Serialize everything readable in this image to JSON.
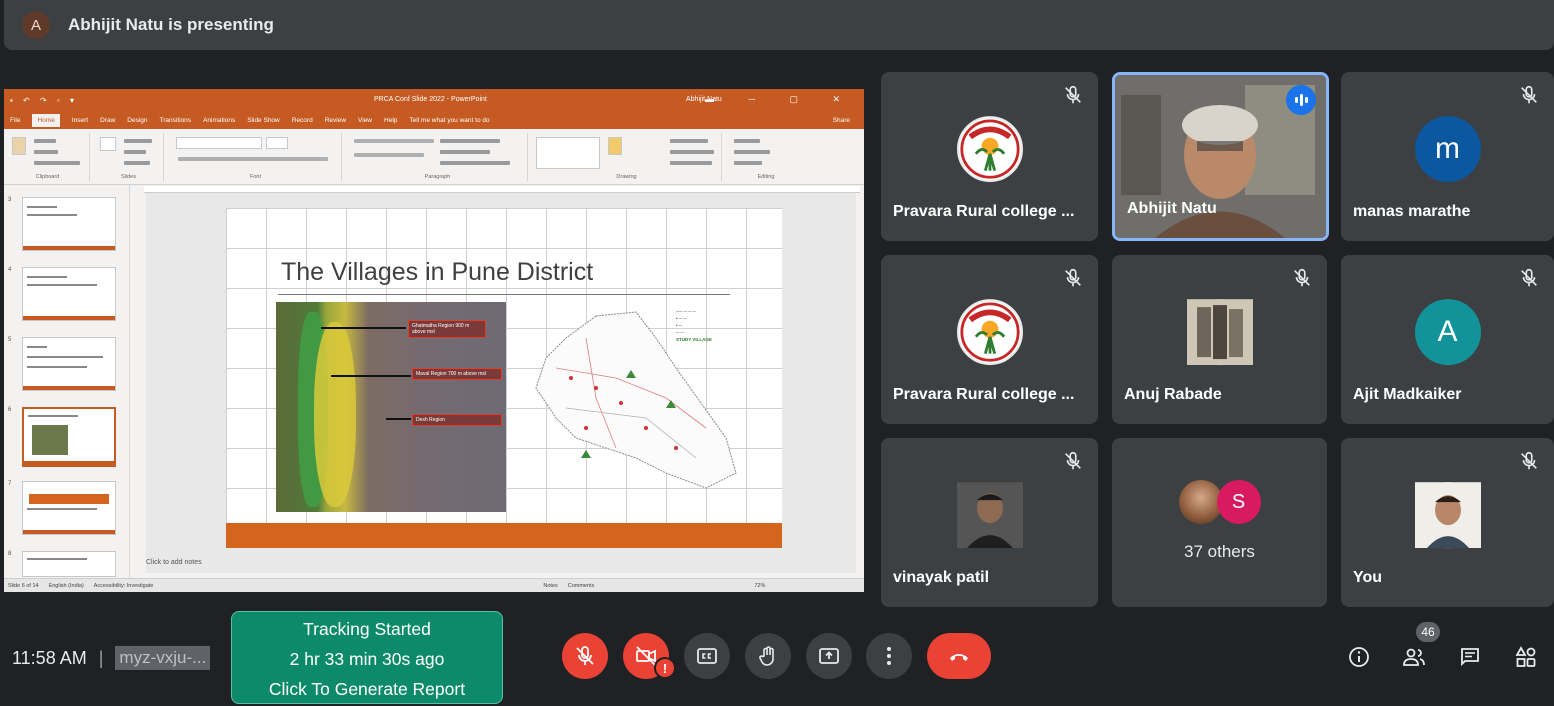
{
  "presenter_banner": {
    "avatar_letter": "A",
    "text": "Abhijit Natu is presenting"
  },
  "shared_screen": {
    "window_title": "PRCA Conf Slide 2022 - PowerPoint",
    "user": "Abhijit Natu",
    "ribbon_tabs": [
      "File",
      "Home",
      "Insert",
      "Draw",
      "Design",
      "Transitions",
      "Animations",
      "Slide Show",
      "Record",
      "Review",
      "View",
      "Help",
      "Tell me what you want to do"
    ],
    "share_label": "Share",
    "ribbon_groups": [
      "Clipboard",
      "Slides",
      "Font",
      "Paragraph",
      "Drawing",
      "Editing"
    ],
    "slide_numbers": [
      "3",
      "4",
      "5",
      "6",
      "7",
      "8"
    ],
    "slide_title": "The Villages in Pune District",
    "callouts": [
      "Ghatmatha Region 900 m above msl",
      "Maval Region 700 m above msl",
      "Desh Region"
    ],
    "map_legend_title": "STUDY VILLAGE",
    "notes_placeholder": "Click to add notes",
    "status_left": "Slide 6 of 14",
    "status_lang": "English (India)",
    "status_access": "Accessibility: Investigate",
    "status_notes": "Notes",
    "status_comments": "Comments",
    "zoom": "72%"
  },
  "participants": [
    {
      "name": "Pravara Rural college ...",
      "type": "logo",
      "muted": true
    },
    {
      "name": "Abhijit Natu",
      "type": "video",
      "speaking": true
    },
    {
      "name": "manas marathe",
      "type": "letter",
      "letter": "m",
      "color": "#0b57a0",
      "muted": true
    },
    {
      "name": "Pravara Rural college ...",
      "type": "logo",
      "muted": true
    },
    {
      "name": "Anuj Rabade",
      "type": "photo",
      "muted": true
    },
    {
      "name": "Ajit Madkaiker",
      "type": "letter",
      "letter": "A",
      "color": "#12939a",
      "muted": true
    },
    {
      "name": "vinayak patil",
      "type": "photo",
      "muted": true
    },
    {
      "name": "37 others",
      "type": "others",
      "letter": "S"
    },
    {
      "name": "You",
      "type": "photo",
      "muted": true
    }
  ],
  "bottom_bar": {
    "time": "11:58 AM",
    "meeting_code": "myz-vxju-...",
    "tracking": {
      "line1": "Tracking Started",
      "line2": "2 hr 33 min 30s ago",
      "line3": "Click To Generate Report"
    },
    "people_count": "46",
    "warning_glyph": "!"
  },
  "colors": {
    "background": "#202124",
    "tile": "#3c4043",
    "danger": "#ea4335",
    "accent": "#8ab4f8",
    "tracking": "#0c8a6a"
  }
}
